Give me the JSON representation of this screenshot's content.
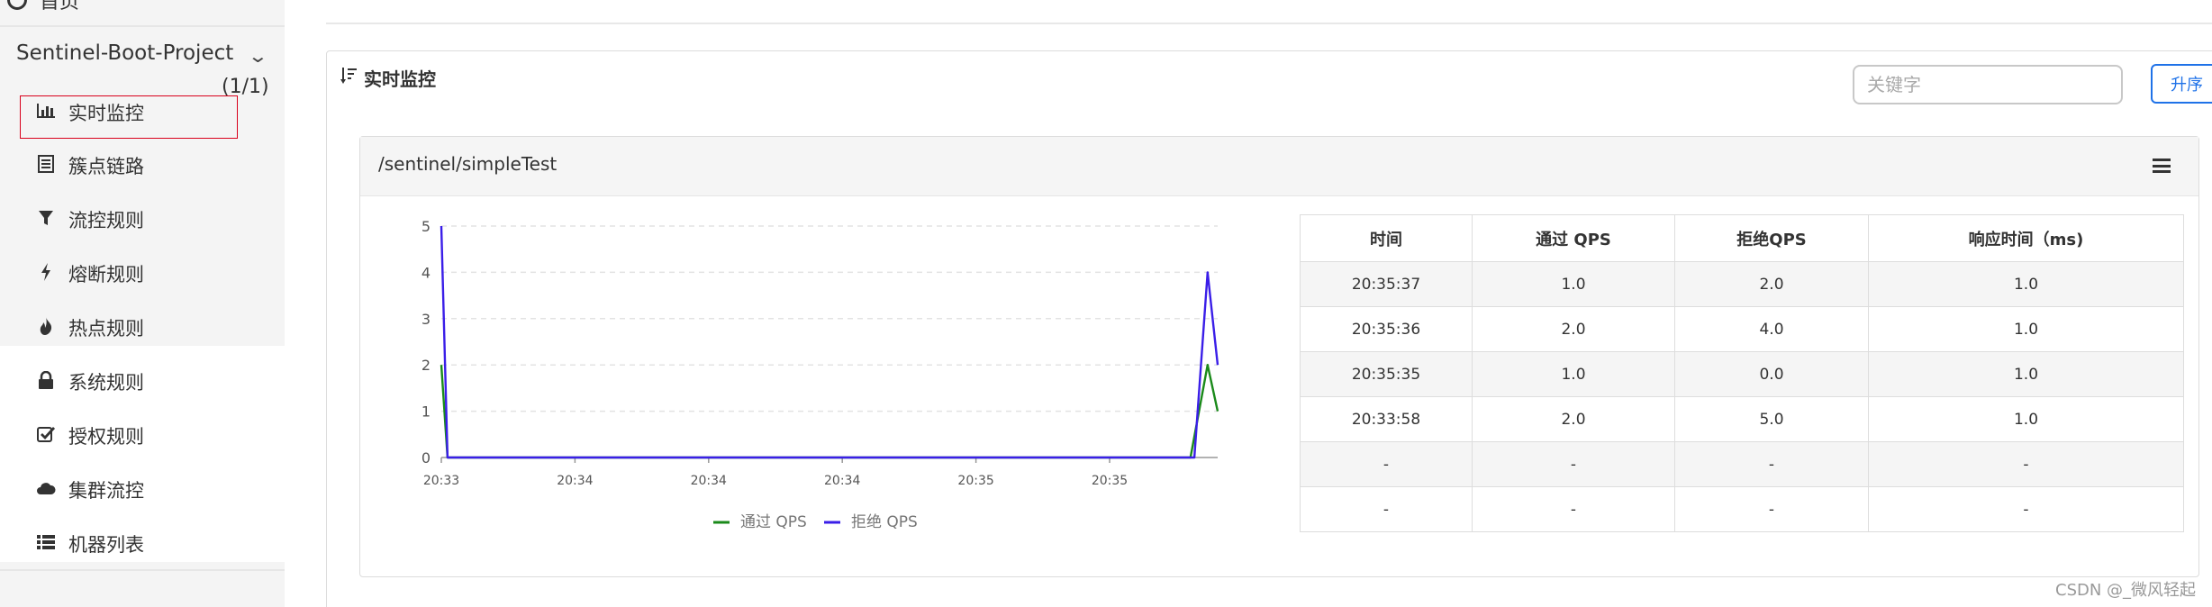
{
  "sidebar": {
    "home_label": "首页",
    "project_name": "Sentinel-Boot-Project",
    "machine_count": "(1/1)",
    "items": [
      {
        "label": "实时监控",
        "icon": "bar-chart-icon"
      },
      {
        "label": "簇点链路",
        "icon": "list-icon"
      },
      {
        "label": "流控规则",
        "icon": "filter-icon"
      },
      {
        "label": "熔断规则",
        "icon": "bolt-icon"
      },
      {
        "label": "热点规则",
        "icon": "fire-icon"
      },
      {
        "label": "系统规则",
        "icon": "lock-icon"
      },
      {
        "label": "授权规则",
        "icon": "check-icon"
      },
      {
        "label": "集群流控",
        "icon": "cloud-icon"
      },
      {
        "label": "机器列表",
        "icon": "list-ul-icon"
      }
    ]
  },
  "panel": {
    "title": "实时监控",
    "search_placeholder": "关键字",
    "sort_label": "升序"
  },
  "card": {
    "resource": "/sentinel/simpleTest"
  },
  "chart_data": {
    "type": "line",
    "x": [
      "20:33",
      "20:34",
      "20:34",
      "20:34",
      "20:35",
      "20:35"
    ],
    "ylim": [
      0,
      5
    ],
    "yticks": [
      0,
      1,
      2,
      3,
      4,
      5
    ],
    "grid": true,
    "legend": "bottom",
    "series": [
      {
        "name": "通过 QPS",
        "color": "#1a8a1a",
        "points": [
          [
            0,
            2
          ],
          [
            0.008,
            0
          ],
          [
            0.965,
            0
          ],
          [
            0.987,
            2
          ],
          [
            1.0,
            1
          ]
        ]
      },
      {
        "name": "拒绝 QPS",
        "color": "#3a1ee8",
        "points": [
          [
            0,
            5
          ],
          [
            0.008,
            0
          ],
          [
            0.97,
            0
          ],
          [
            0.987,
            4
          ],
          [
            1.0,
            2
          ]
        ]
      }
    ]
  },
  "table": {
    "headers": [
      "时间",
      "通过 QPS",
      "拒绝QPS",
      "响应时间（ms)"
    ],
    "rows": [
      [
        "20:35:37",
        "1.0",
        "2.0",
        "1.0"
      ],
      [
        "20:35:36",
        "2.0",
        "4.0",
        "1.0"
      ],
      [
        "20:35:35",
        "1.0",
        "0.0",
        "1.0"
      ],
      [
        "20:33:58",
        "2.0",
        "5.0",
        "1.0"
      ],
      [
        "-",
        "-",
        "-",
        "-"
      ],
      [
        "-",
        "-",
        "-",
        "-"
      ]
    ]
  },
  "watermark": "CSDN @_微风轻起"
}
